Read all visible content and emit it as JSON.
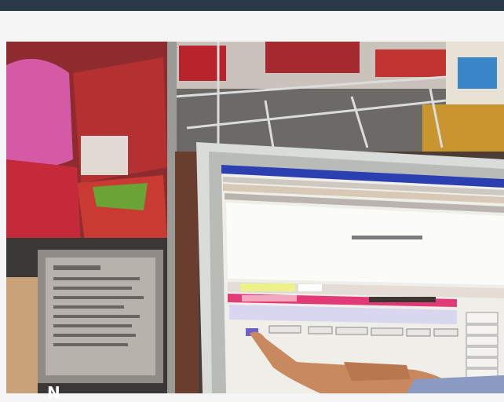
{
  "page": {
    "caption_fragment": "N"
  },
  "scene": {
    "description_tags": [
      "shop-shelves",
      "snack-bags",
      "computer-monitor",
      "pointing-hand"
    ],
    "colors": {
      "topbar": "#2b3a4a",
      "page_bg": "#f5f5f5",
      "monitor_bezel": "#d9dcd8",
      "screen_bg": "#efeee9",
      "screen_titlebar": "#2c3fb0",
      "highlight_pink": "#e23a76",
      "highlight_yellow": "#eef08a"
    }
  }
}
